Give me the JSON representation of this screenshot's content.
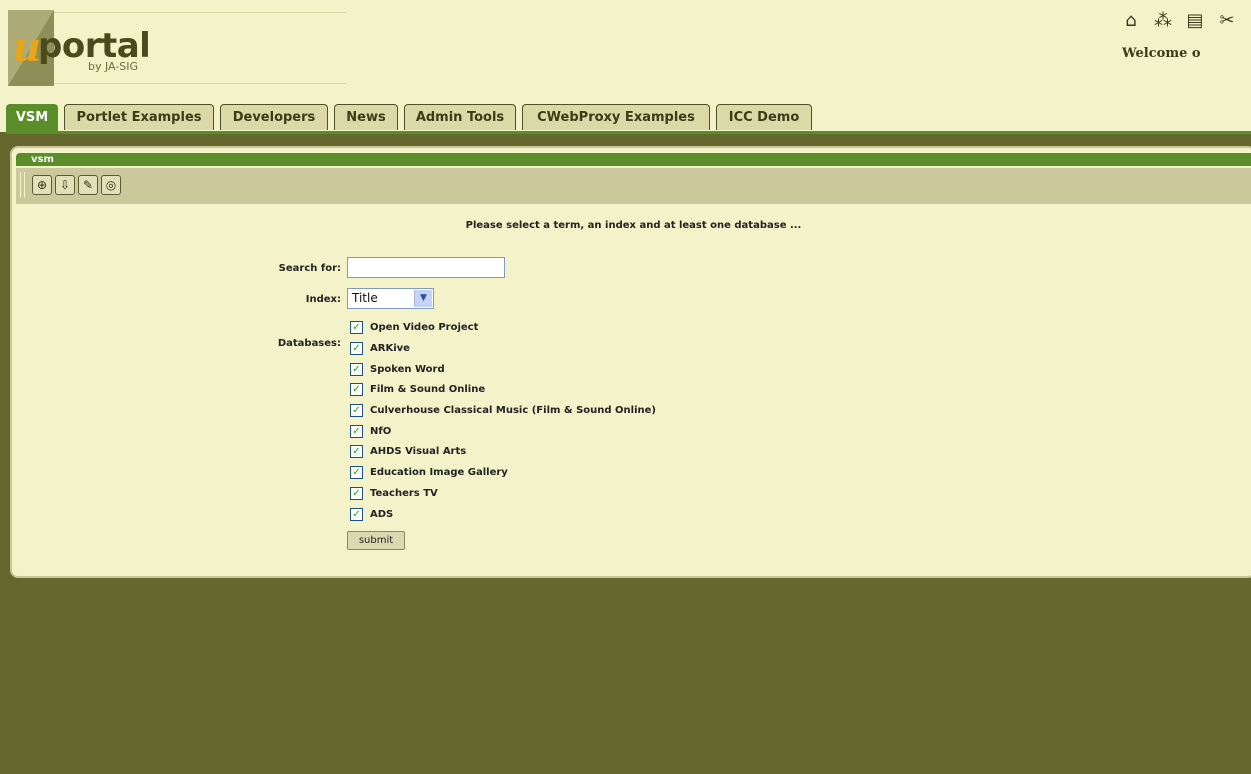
{
  "header": {
    "logo_letter": "u",
    "logo_word": "portal",
    "logo_by": "by JA-SIG",
    "welcome": "Welcome o",
    "icons": [
      "home-icon",
      "layout-icon",
      "preferences-icon",
      "tools-icon"
    ]
  },
  "tabs": [
    {
      "label": "VSM",
      "active": true
    },
    {
      "label": "Portlet Examples"
    },
    {
      "label": "Developers"
    },
    {
      "label": "News"
    },
    {
      "label": "Admin Tools"
    },
    {
      "label": "CWebProxy Examples"
    },
    {
      "label": "ICC Demo"
    }
  ],
  "portlet": {
    "title": "vsm",
    "toolbar": [
      "zoom-icon",
      "download-icon",
      "edit-icon",
      "database-icon"
    ],
    "instructions": "Please select a term, an index and at least one database ...",
    "search_label": "Search for:",
    "search_value": "",
    "index_label": "Index:",
    "index_value": "Title",
    "databases_label": "Databases:",
    "databases": [
      {
        "label": "Open Video Project",
        "checked": true
      },
      {
        "label": "ARKive",
        "checked": true
      },
      {
        "label": "Spoken Word",
        "checked": true
      },
      {
        "label": "Film & Sound Online",
        "checked": true
      },
      {
        "label": "Culverhouse Classical Music (Film & Sound Online)",
        "checked": true
      },
      {
        "label": "NfO",
        "checked": true
      },
      {
        "label": "AHDS Visual Arts",
        "checked": true
      },
      {
        "label": "Education Image Gallery",
        "checked": true
      },
      {
        "label": "Teachers TV",
        "checked": true
      },
      {
        "label": "ADS",
        "checked": true
      }
    ],
    "submit_label": "submit"
  },
  "colors": {
    "background": "#66672f",
    "header": "#f4f2c9",
    "accent_green": "#5b8d2a",
    "toolbar": "#cbc99b",
    "logo_orange": "#e8a51a"
  }
}
